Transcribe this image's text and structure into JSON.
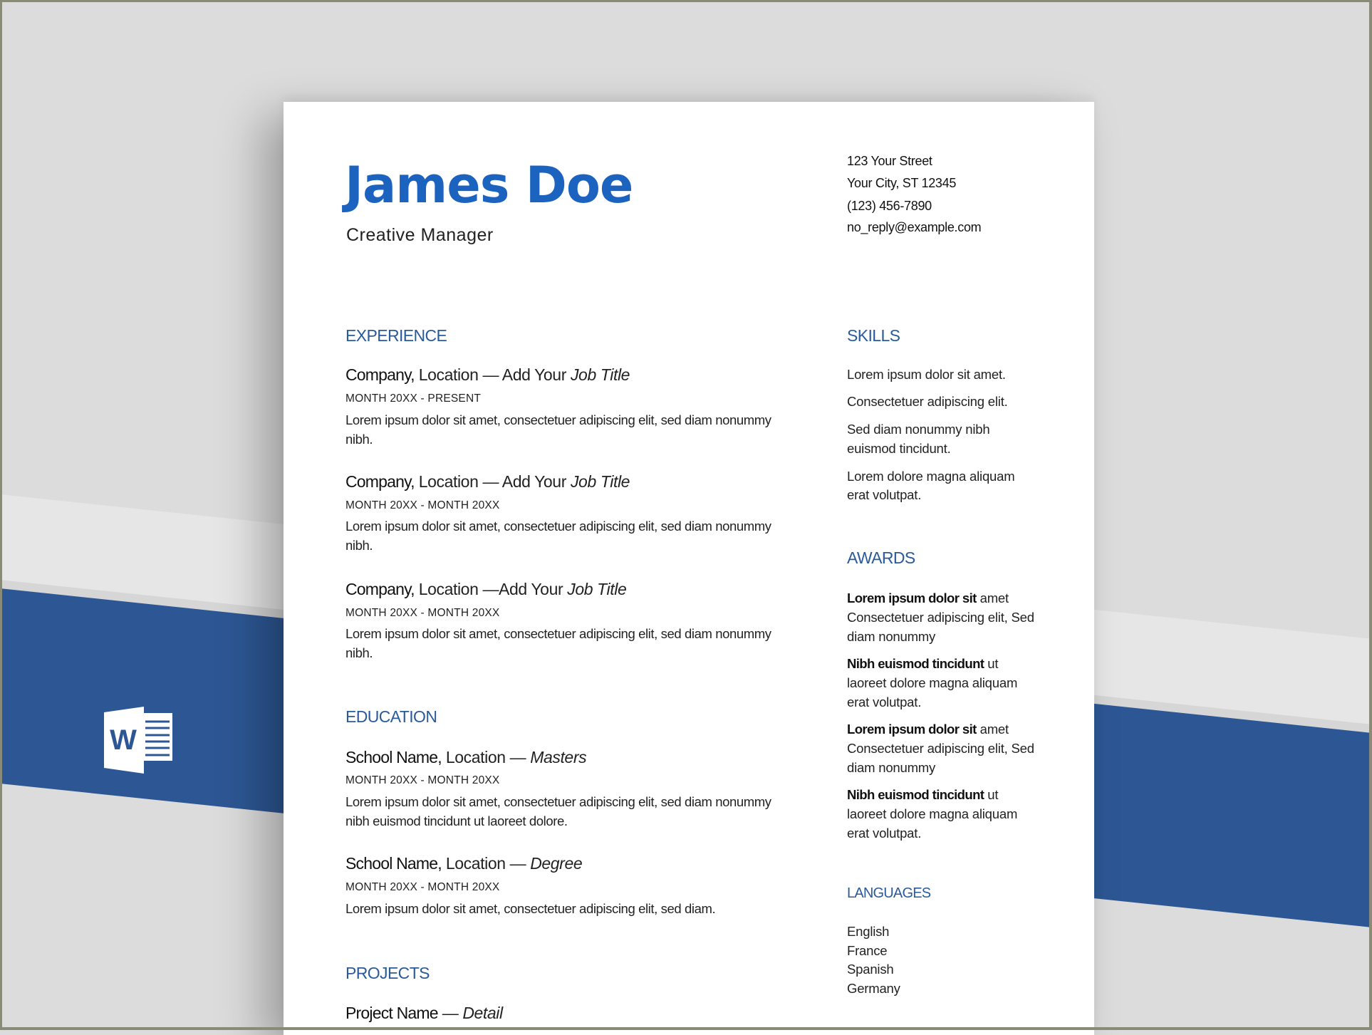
{
  "colors": {
    "background": "#dcdcdc",
    "band_light": "#e6e6e6",
    "band_blue": "#2d5794",
    "name_blue": "#1c63c0",
    "heading_blue": "#2a5a9a"
  },
  "decoration": {
    "app_icon": "word-icon",
    "app_icon_letter": "W"
  },
  "header": {
    "name": "James Doe",
    "title": "Creative Manager",
    "contact": {
      "street": "123 Your Street",
      "city": "Your City, ST 12345",
      "phone": "(123) 456-7890",
      "email": "no_reply@example.com"
    }
  },
  "experience": {
    "heading": "EXPERIENCE",
    "items": [
      {
        "company": "Company,",
        "location": " Location — Add Your ",
        "title": "Job Title",
        "dates": "MONTH 20XX - PRESENT",
        "desc_line1": "Lorem ipsum dolor sit amet, consectetuer adipiscing elit, sed diam nonummy",
        "desc_line2": "nibh."
      },
      {
        "company": "Company,",
        "location": " Location — Add Your ",
        "title": "Job Title",
        "dates": "MONTH 20XX - MONTH 20XX",
        "desc_line1": "Lorem ipsum dolor sit amet, consectetuer adipiscing elit, sed diam nonummy",
        "desc_line2": "nibh."
      },
      {
        "company": "Company,",
        "location": " Location —Add Your ",
        "title": "Job Title",
        "dates": "MONTH 20XX - MONTH 20XX",
        "desc_line1": "Lorem ipsum dolor sit amet, consectetuer adipiscing elit, sed diam nonummy",
        "desc_line2": "nibh."
      }
    ]
  },
  "education": {
    "heading": "EDUCATION",
    "items": [
      {
        "school": "School Name,",
        "location": " Location — ",
        "degree": "Masters",
        "dates": "MONTH 20XX - MONTH 20XX",
        "desc_line1": "Lorem ipsum dolor sit amet, consectetuer adipiscing elit, sed diam nonummy",
        "desc_line2": "nibh euismod tincidunt ut laoreet dolore."
      },
      {
        "school": "School Name,",
        "location": " Location — ",
        "degree": "Degree",
        "dates": "MONTH 20XX - MONTH 20XX",
        "desc_line1": "Lorem ipsum dolor sit amet, consectetuer adipiscing elit, sed diam."
      }
    ]
  },
  "projects": {
    "heading": "PROJECTS",
    "items": [
      {
        "name": "Project Name",
        "sep": " — ",
        "detail": "Detail"
      }
    ]
  },
  "skills": {
    "heading": "SKILLS",
    "items": [
      {
        "line1": "Lorem ipsum dolor sit amet."
      },
      {
        "line1": "Consectetuer adipiscing elit."
      },
      {
        "line1": "Sed diam nonummy nibh",
        "line2": "euismod tincidunt."
      },
      {
        "line1": "Lorem dolore magna aliquam",
        "line2": "erat volutpat."
      }
    ]
  },
  "awards": {
    "heading": "AWARDS",
    "items": [
      {
        "bold": "Lorem ipsum dolor sit",
        "rest": " amet",
        "line2": "Consectetuer adipiscing elit, Sed",
        "line3": "diam nonummy"
      },
      {
        "bold": "Nibh euismod tincidunt",
        "rest": " ut",
        "line2": "laoreet dolore magna aliquam",
        "line3": "erat volutpat."
      },
      {
        "bold": "Lorem ipsum dolor sit",
        "rest": " amet",
        "line2": "Consectetuer adipiscing elit, Sed",
        "line3": "diam nonummy"
      },
      {
        "bold": "Nibh euismod tincidunt",
        "rest": " ut",
        "line2": "laoreet dolore magna aliquam",
        "line3": "erat volutpat."
      }
    ]
  },
  "languages": {
    "heading": "LANGUAGES",
    "items": [
      "English",
      "France",
      "Spanish",
      "Germany"
    ]
  }
}
